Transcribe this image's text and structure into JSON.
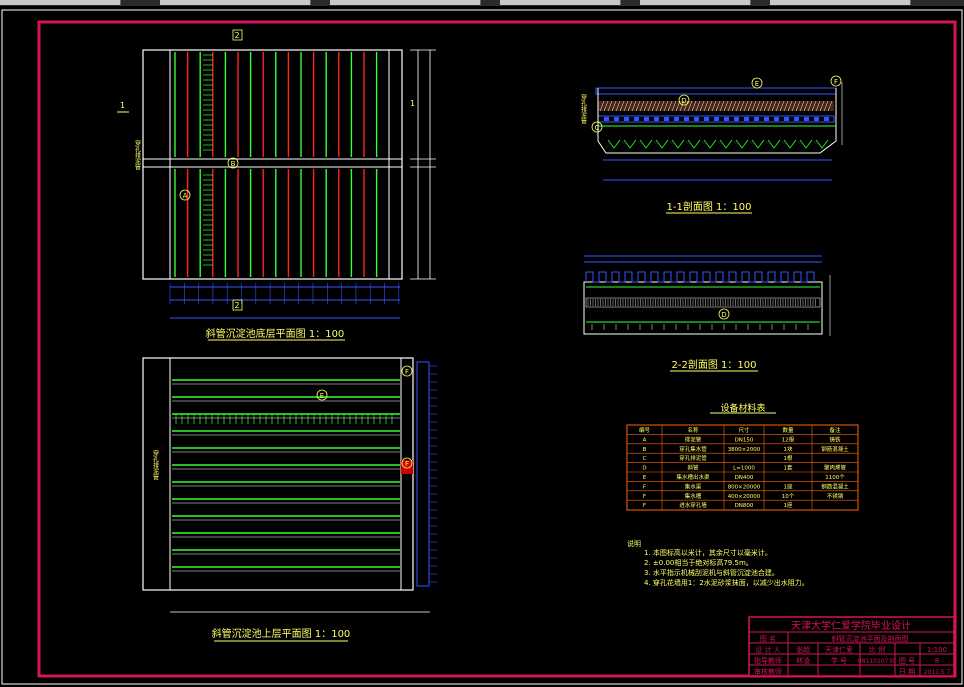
{
  "titles": {
    "bottom_plan": "斜管沉淀池底层平面图 1：100",
    "top_plan": "斜管沉淀池上层平面图 1：100",
    "section_11": "1-1剖面图 1：100",
    "section_22": "2-2剖面图 1：100",
    "materials": "设备材料表"
  },
  "markers": {
    "A": "A",
    "B": "B",
    "C": "C",
    "D": "D",
    "E": "E",
    "F": "F",
    "sec1": "1",
    "sec2": "2"
  },
  "side_labels": {
    "left_vertical": "穿孔排泥管"
  },
  "materials_table": {
    "headers": [
      "编号",
      "名称",
      "尺寸",
      "数量",
      "备注"
    ],
    "rows": [
      [
        "A",
        "排泥管",
        "DN150",
        "12根",
        "铸铁"
      ],
      [
        "B",
        "穿孔集水管",
        "3800×2000",
        "1块",
        "钢筋混凝土"
      ],
      [
        "C",
        "穿孔排泥管",
        "",
        "1根",
        ""
      ],
      [
        "D",
        "斜管",
        "L=1000",
        "1套",
        "聚丙烯管"
      ],
      [
        "E",
        "集水槽出水渠",
        "DN400",
        "",
        "1100个"
      ],
      [
        "F",
        "集水渠",
        "800×20000",
        "1座",
        "钢筋混凝土"
      ],
      [
        "F",
        "集水槽",
        "400×20000",
        "10个",
        "不锈钢"
      ],
      [
        "F",
        "进水穿孔墙",
        "DN800",
        "1座",
        ""
      ]
    ]
  },
  "notes": {
    "heading": "说明",
    "items": [
      "1.  本图标高以米计，其余尺寸以毫米计。",
      "2.  ±0.00相当于绝对标高79.5m。",
      "3.  水平指示机械刮泥机与斜管沉淀池合建。",
      "4.  穿孔花墙用1：2水泥砂浆抹面，以减少出水阻力。"
    ]
  },
  "title_block": {
    "school": "天津大学仁爱学院毕业设计",
    "row1": [
      "图  名",
      "斜管沉淀池平面及剖面图"
    ],
    "row2": [
      "设 计 人",
      "张超",
      "天津仁爱",
      "比 例",
      "1:100"
    ],
    "row3": [
      "指导教师",
      "林凌",
      "学 号",
      "0811010730",
      "图 号",
      "8"
    ],
    "row4": [
      "审核教师",
      "",
      "",
      "",
      "日 期",
      "2011.5.7"
    ]
  }
}
